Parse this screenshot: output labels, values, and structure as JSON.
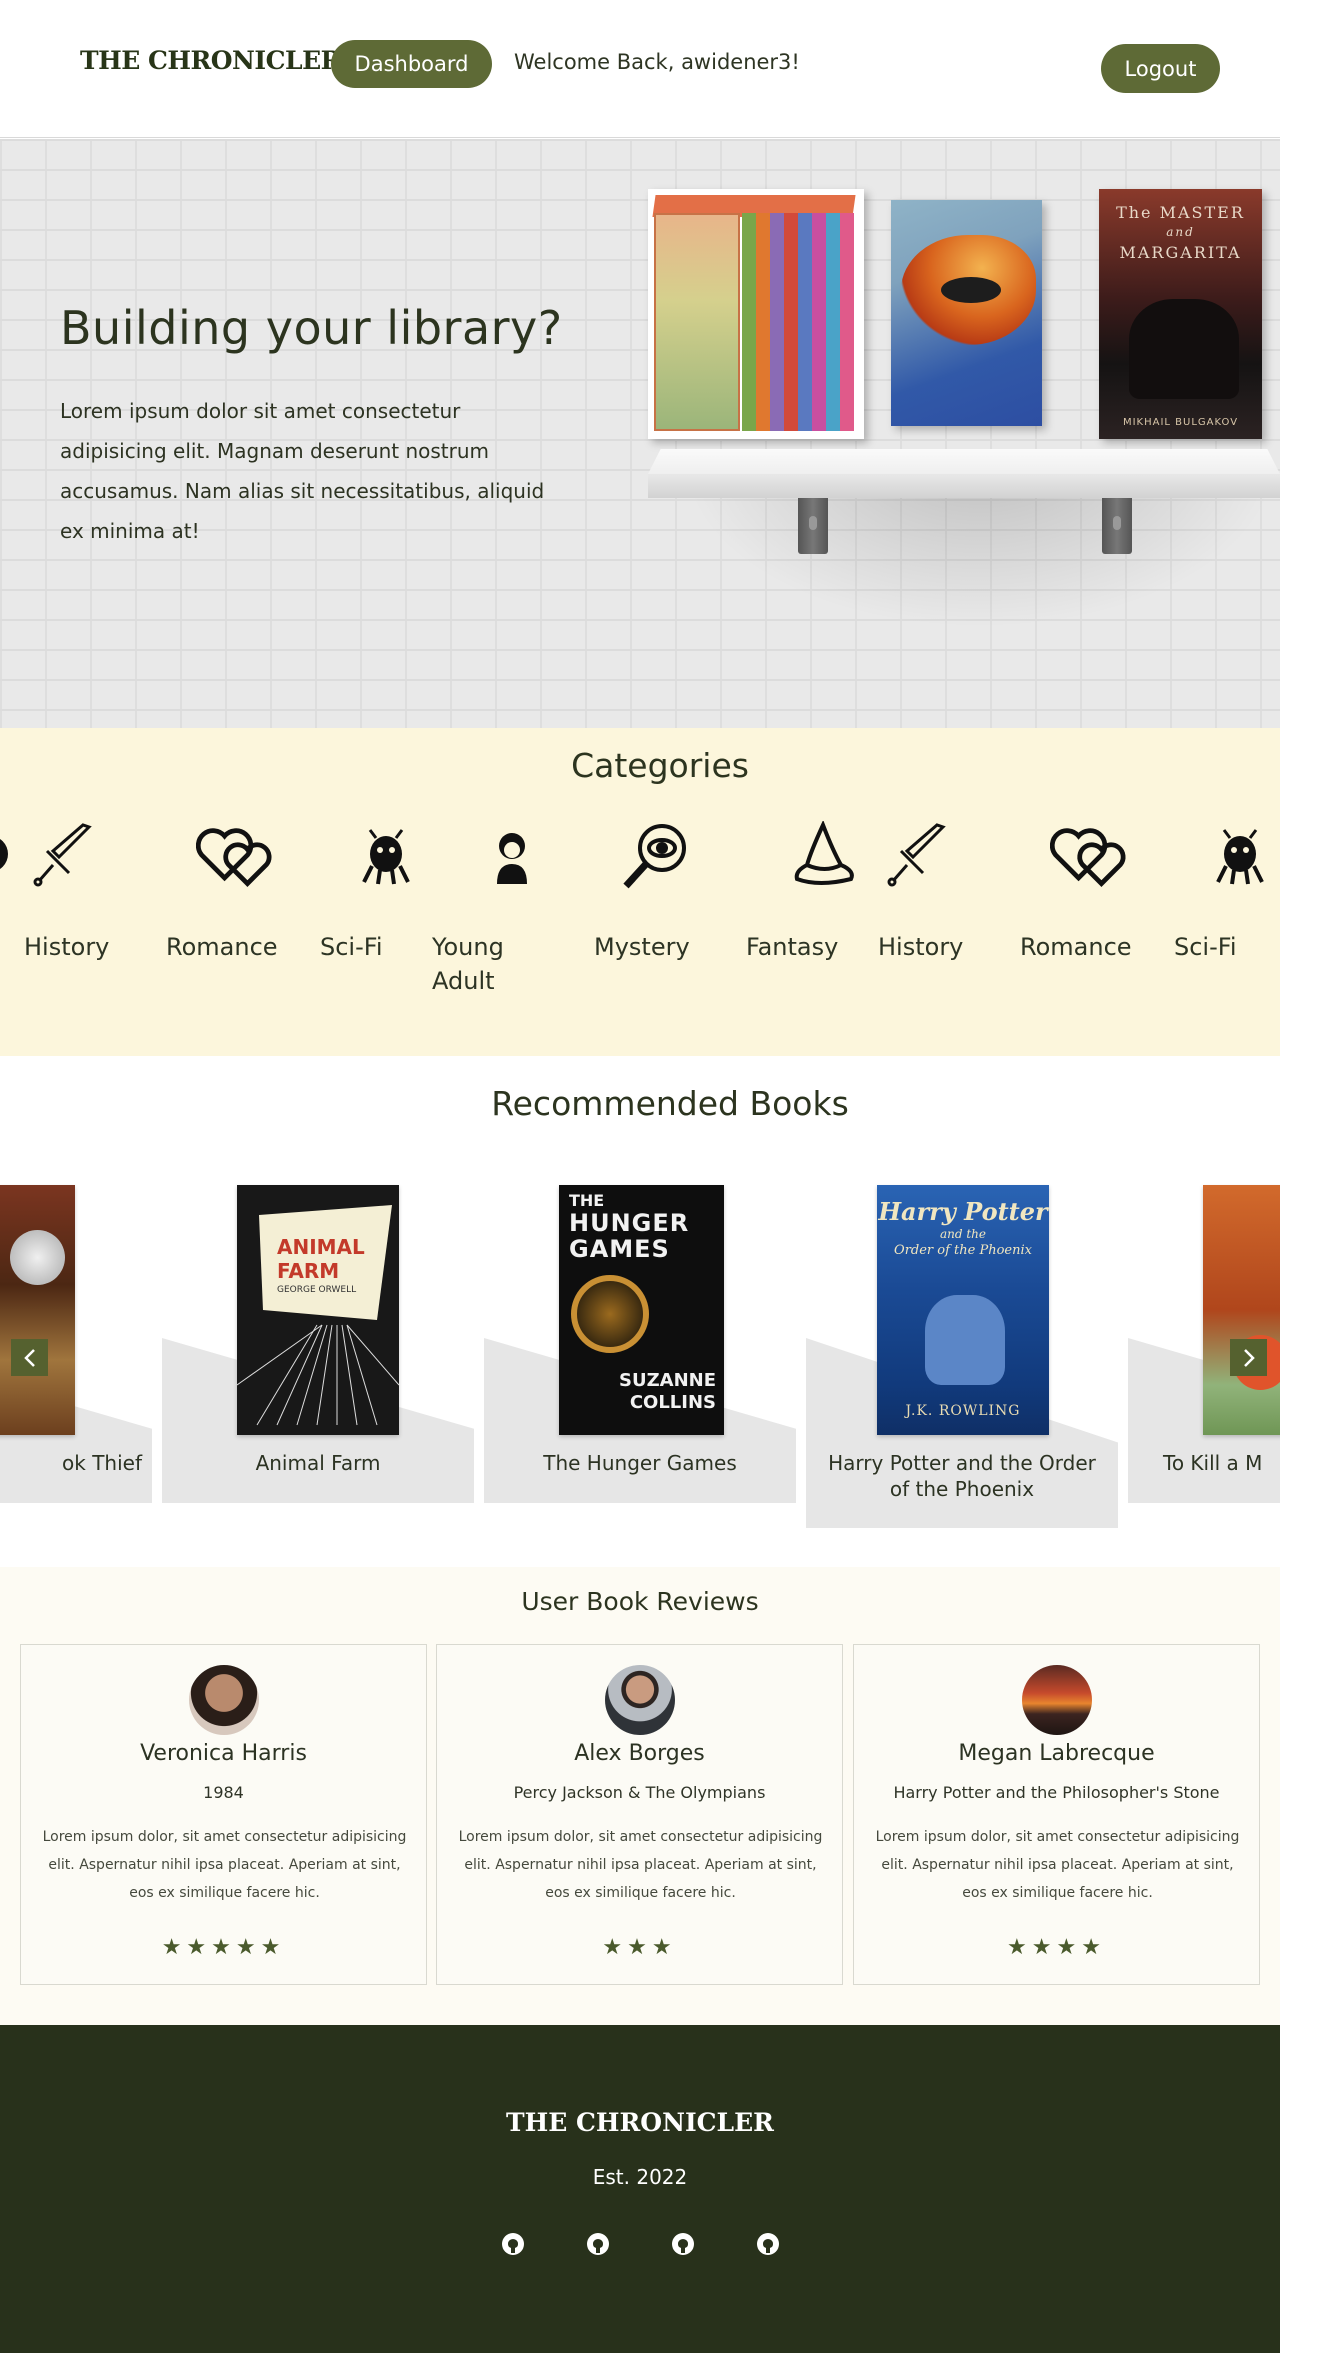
{
  "header": {
    "brand": "THE CHRONICLER",
    "dashboard_label": "Dashboard",
    "welcome": "Welcome Back, awidener3!",
    "logout_label": "Logout"
  },
  "hero": {
    "title": "Building your library?",
    "text": "Lorem ipsum dolor sit amet consectetur adipisicing elit. Magnam deserunt nostrum accusamus. Nam alias sit necessitatibus, aliquid ex minima at!",
    "books": {
      "master_title_1": "The MASTER",
      "master_title_2": "and",
      "master_title_3": "MARGARITA",
      "master_author": "MIKHAIL BULGAKOV"
    }
  },
  "categories": {
    "title": "Categories",
    "items": [
      {
        "label": "History",
        "icon": "sword-icon"
      },
      {
        "label": "Romance",
        "icon": "hearts-icon"
      },
      {
        "label": "Sci-Fi",
        "icon": "alien-icon"
      },
      {
        "label": "Young Adult",
        "icon": "teen-icon"
      },
      {
        "label": "Mystery",
        "icon": "magnifier-eye-icon"
      },
      {
        "label": "Fantasy",
        "icon": "wizard-hat-icon"
      },
      {
        "label": "History",
        "icon": "sword-icon"
      },
      {
        "label": "Romance",
        "icon": "hearts-icon"
      },
      {
        "label": "Sci-Fi",
        "icon": "alien-icon"
      }
    ]
  },
  "recommended": {
    "title": "Recommended Books",
    "books": [
      {
        "title": "The Book Thief",
        "visible_text": "ok Thief"
      },
      {
        "title": "Animal Farm"
      },
      {
        "title": "The Hunger Games"
      },
      {
        "title": "Harry Potter and the Order of the Phoenix"
      },
      {
        "title": "To Kill a Mockingbird",
        "visible_text": "To Kill a M"
      }
    ],
    "covers": {
      "animal_farm_1": "ANIMAL",
      "animal_farm_2": "FARM",
      "animal_farm_author": "GEORGE ORWELL",
      "hunger_1": "THE",
      "hunger_2": "HUNGER",
      "hunger_3": "GAMES",
      "hunger_author_1": "SUZANNE",
      "hunger_author_2": "COLLINS",
      "hp_1": "Harry Potter",
      "hp_2": "and the",
      "hp_3": "Order of the Phoenix",
      "hp_author": "J.K. ROWLING"
    },
    "prev_icon": "chevron-left-icon",
    "next_icon": "chevron-right-icon"
  },
  "reviews": {
    "title": "User Book Reviews",
    "items": [
      {
        "name": "Veronica Harris",
        "book": "1984",
        "text": "Lorem ipsum dolor, sit amet consectetur adipisicing elit. Aspernatur nihil ipsa placeat. Aperiam at sint, eos ex similique facere hic.",
        "rating": 5,
        "stars": "★★★★★"
      },
      {
        "name": "Alex Borges",
        "book": "Percy Jackson & The Olympians",
        "text": "Lorem ipsum dolor, sit amet consectetur adipisicing elit. Aspernatur nihil ipsa placeat. Aperiam at sint, eos ex similique facere hic.",
        "rating": 3,
        "stars": "★★★"
      },
      {
        "name": "Megan Labrecque",
        "book": "Harry Potter and the Philosopher's Stone",
        "text": "Lorem ipsum dolor, sit amet consectetur adipisicing elit. Aspernatur nihil ipsa placeat. Aperiam at sint, eos ex similique facere hic.",
        "rating": 4,
        "stars": "★★★★"
      }
    ]
  },
  "footer": {
    "brand": "THE CHRONICLER",
    "est": "Est. 2022",
    "links": [
      "github-icon",
      "github-icon",
      "github-icon",
      "github-icon"
    ]
  },
  "colors": {
    "accent": "#5e6a36",
    "categories_bg": "#fcf6dc",
    "footer_bg": "#28311b"
  }
}
